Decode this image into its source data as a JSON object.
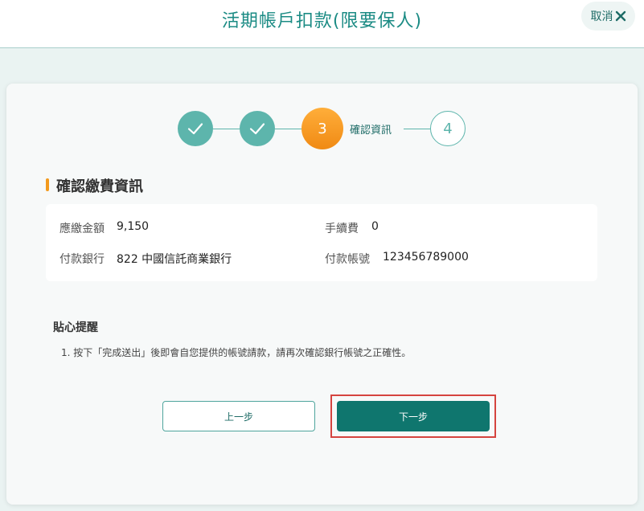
{
  "header": {
    "title": "活期帳戶扣款(限要保人)",
    "cancel_label": "取消"
  },
  "steps": {
    "current_number": "3",
    "current_label": "確認資訊",
    "next_number": "4"
  },
  "section": {
    "title": "確認繳費資訊"
  },
  "info": {
    "amount_label": "應繳金額",
    "amount_value": "9,150",
    "fee_label": "手續費",
    "fee_value": "0",
    "bank_label": "付款銀行",
    "bank_value": "822 中國信託商業銀行",
    "account_label": "付款帳號",
    "account_value": "123456789000"
  },
  "tips": {
    "title": "貼心提醒",
    "items": [
      "1. 按下「完成送出」後即會自您提供的帳號請款，請再次確認銀行帳號之正確性。"
    ]
  },
  "buttons": {
    "prev_label": "上一步",
    "next_label": "下一步"
  },
  "colors": {
    "brand": "#1b8b84",
    "accent": "#f39a1e",
    "primary_button": "#0f766e",
    "highlight": "#d5443f"
  }
}
